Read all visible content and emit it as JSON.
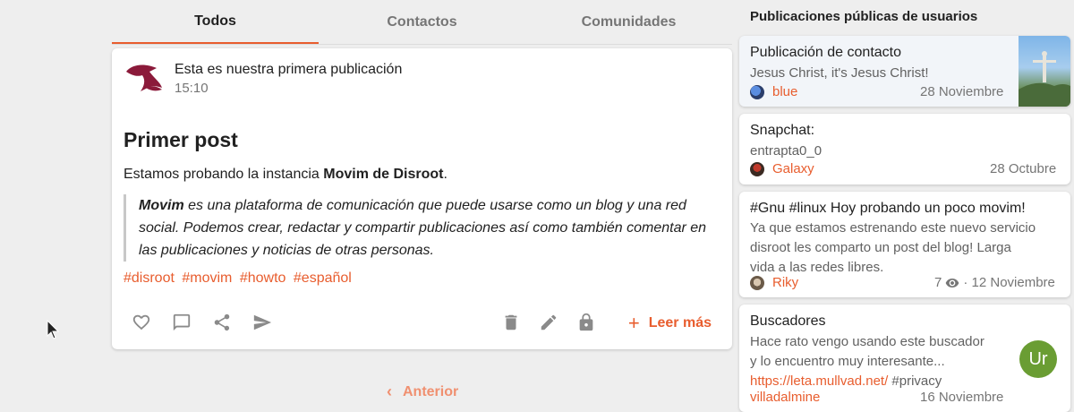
{
  "tabs": [
    {
      "label": "Todos",
      "active": true
    },
    {
      "label": "Contactos",
      "active": false
    },
    {
      "label": "Comunidades",
      "active": false
    }
  ],
  "post": {
    "subtitle": "Esta es nuestra primera publicación",
    "time": "15:10",
    "title": "Primer post",
    "intro_prefix": "Estamos probando la instancia ",
    "intro_bold": "Movim de Disroot",
    "intro_suffix": ".",
    "quote_bold": "Movim",
    "quote_text": " es una plataforma de comunicación que puede usarse como un blog y una red social. Podemos crear, redactar y compartir publicaciones así como también comentar en las publicaciones y noticias de otras personas.",
    "tags": [
      "#disroot",
      "#movim",
      "#howto",
      "#español"
    ],
    "read_more": "Leer más",
    "icons": [
      "heart-icon",
      "comment-icon",
      "share-icon",
      "send-icon",
      "delete-icon",
      "edit-icon",
      "lock-icon",
      "plus-icon"
    ]
  },
  "pagination": {
    "prev_label": "Anterior"
  },
  "sidebar": {
    "title": "Publicaciones públicas de usuarios",
    "cards": [
      {
        "title": "Publicación de contacto",
        "body": "Jesus Christ, it's Jesus Christ!",
        "user": "blue",
        "date": "28 Noviembre"
      },
      {
        "title": "Snapchat:",
        "body": "entrapta0_0",
        "user": "Galaxy",
        "date": "28 Octubre"
      },
      {
        "title": "#Gnu #linux Hoy probando un poco movim!",
        "body_lines": [
          "Ya que estamos estrenando este nuevo servicio",
          "disroot les comparto un post del blog! Larga",
          "vida a las redes libres."
        ],
        "user": "Riky",
        "views": "7",
        "date": "· 12 Noviembre"
      },
      {
        "title": "Buscadores",
        "body_lines": [
          "Hace rato vengo usando este buscador",
          "y lo encuentro muy interesante..."
        ],
        "link": "https://leta.mullvad.net/",
        "link_tag": " #privacy",
        "user": "villadalmine",
        "date": "16 Noviembre"
      }
    ]
  },
  "fab": {
    "label": "Ur"
  },
  "colors": {
    "accent": "#e85d2e",
    "fab": "#6a9d33",
    "logo": "#8b1a3a"
  }
}
